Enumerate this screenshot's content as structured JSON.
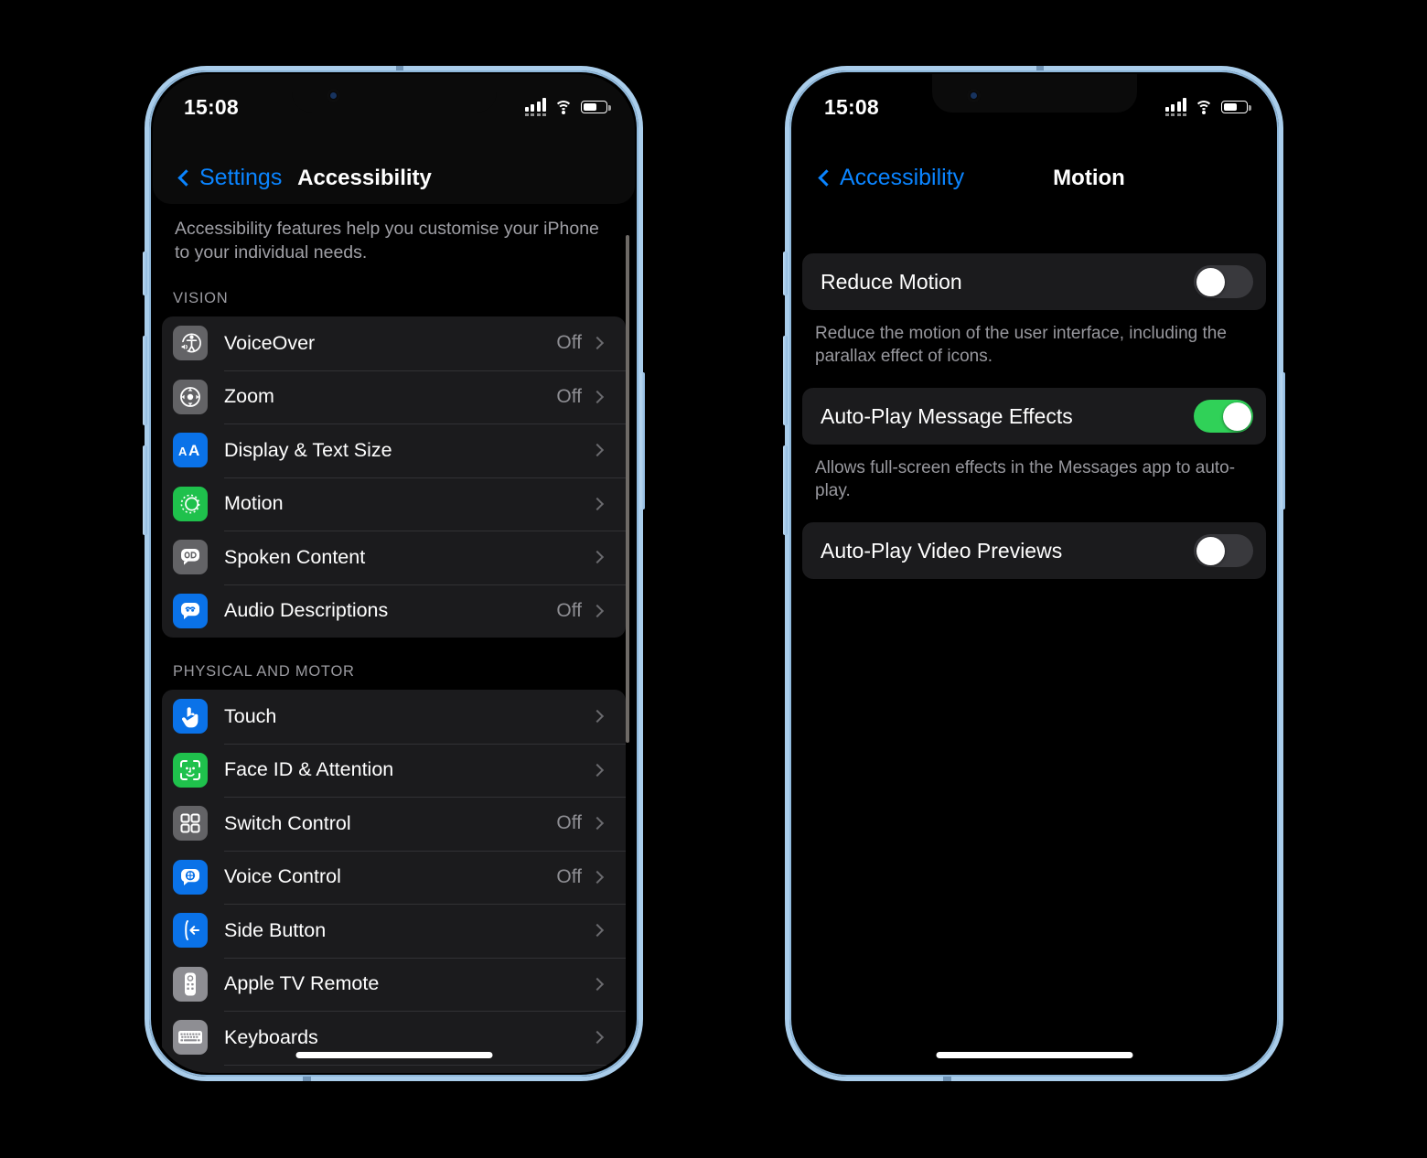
{
  "phones": [
    {
      "id": "accessibility-screen",
      "statusbar": {
        "time": "15:08",
        "cellular": "cellular-signal-icon",
        "wifi": "wifi-icon",
        "battery": "battery-icon"
      },
      "nav": {
        "back_label": "Settings",
        "title": "Accessibility"
      },
      "intro": "Accessibility features help you customise your iPhone to your individual needs.",
      "sections": [
        {
          "header": "VISION",
          "rows": [
            {
              "label": "VoiceOver",
              "value": "Off",
              "icon": "voiceover-icon",
              "icon_bg": "#636366"
            },
            {
              "label": "Zoom",
              "value": "Off",
              "icon": "zoom-icon",
              "icon_bg": "#636366"
            },
            {
              "label": "Display & Text Size",
              "value": "",
              "icon": "display-text-icon",
              "icon_bg": "#0a72e8"
            },
            {
              "label": "Motion",
              "value": "",
              "icon": "motion-icon",
              "icon_bg": "#1fc14c"
            },
            {
              "label": "Spoken Content",
              "value": "",
              "icon": "spoken-content-icon",
              "icon_bg": "#636366"
            },
            {
              "label": "Audio Descriptions",
              "value": "Off",
              "icon": "audio-descriptions-icon",
              "icon_bg": "#0a72e8"
            }
          ]
        },
        {
          "header": "PHYSICAL AND MOTOR",
          "rows": [
            {
              "label": "Touch",
              "value": "",
              "icon": "touch-icon",
              "icon_bg": "#0a72e8"
            },
            {
              "label": "Face ID & Attention",
              "value": "",
              "icon": "face-id-icon",
              "icon_bg": "#1fc14c"
            },
            {
              "label": "Switch Control",
              "value": "Off",
              "icon": "switch-control-icon",
              "icon_bg": "#636366"
            },
            {
              "label": "Voice Control",
              "value": "Off",
              "icon": "voice-control-icon",
              "icon_bg": "#0a72e8"
            },
            {
              "label": "Side Button",
              "value": "",
              "icon": "side-button-icon",
              "icon_bg": "#0a72e8"
            },
            {
              "label": "Apple TV Remote",
              "value": "",
              "icon": "apple-tv-remote-icon",
              "icon_bg": "#8e8e93"
            },
            {
              "label": "Keyboards",
              "value": "",
              "icon": "keyboards-icon",
              "icon_bg": "#8e8e93"
            }
          ]
        }
      ]
    },
    {
      "id": "motion-screen",
      "statusbar": {
        "time": "15:08",
        "cellular": "cellular-signal-icon",
        "wifi": "wifi-icon",
        "battery": "battery-icon"
      },
      "nav": {
        "back_label": "Accessibility",
        "title": "Motion"
      },
      "settings": [
        {
          "label": "Reduce Motion",
          "state": "off",
          "footnote": "Reduce the motion of the user interface, including the parallax effect of icons."
        },
        {
          "label": "Auto-Play Message Effects",
          "state": "on",
          "footnote": "Allows full-screen effects in the Messages app to auto-play."
        },
        {
          "label": "Auto-Play Video Previews",
          "state": "off",
          "footnote": ""
        }
      ]
    }
  ],
  "colors": {
    "accent_blue": "#0a84ff",
    "toggle_on_green": "#30d158",
    "toggle_off_grey": "#39393d",
    "row_bg": "#1b1b1d",
    "frame_blue": "#a9cdeb"
  }
}
